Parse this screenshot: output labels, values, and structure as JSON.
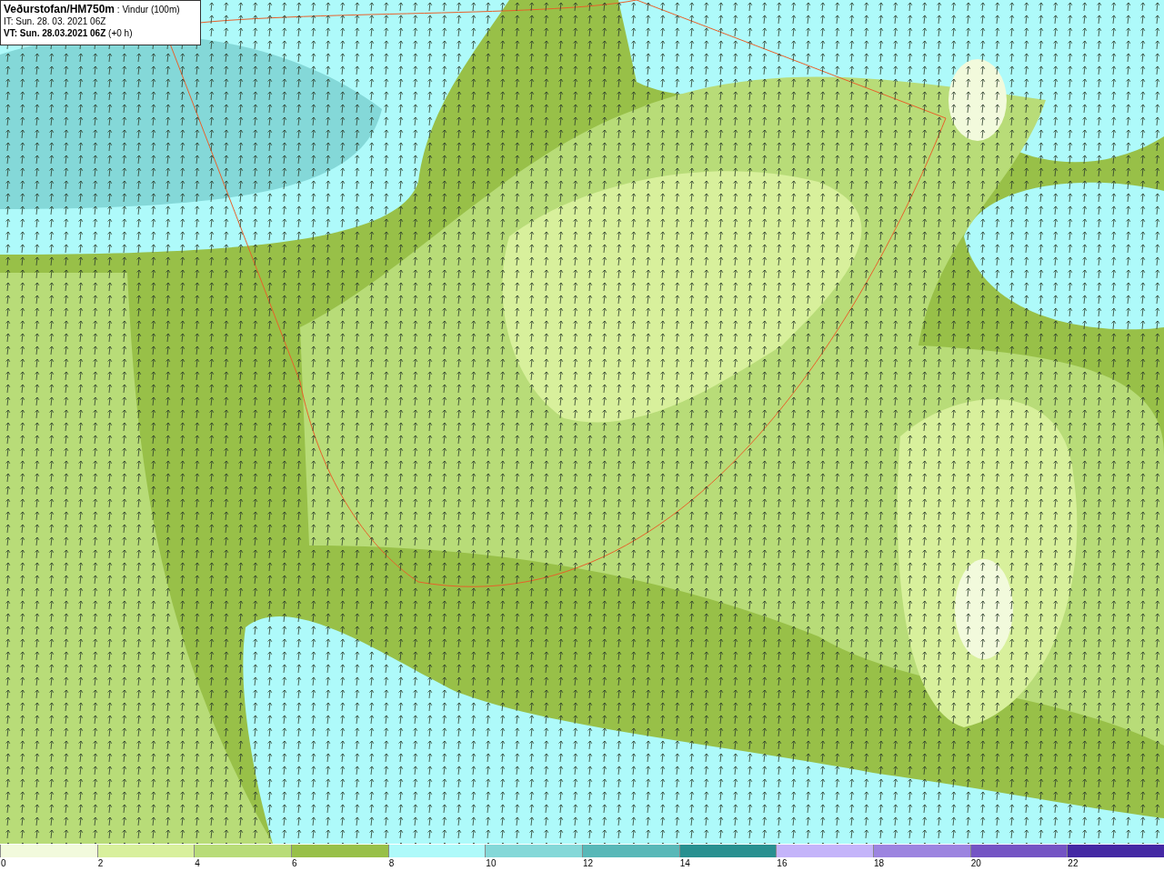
{
  "header": {
    "title": "Veðurstofan/HM750m",
    "subtitle": ": Vindur (100m)",
    "issue_time": "IT: Sun. 28. 03. 2021 06Z",
    "valid_time": "VT: Sun. 28.03.2021 06Z",
    "lead": "(+0 h)"
  },
  "legend": [
    {
      "label": "0",
      "color": "#f2fadc"
    },
    {
      "label": "2",
      "color": "#d8f09c"
    },
    {
      "label": "4",
      "color": "#b8dc78"
    },
    {
      "label": "6",
      "color": "#98c048"
    },
    {
      "label": "8",
      "color": "#aefafa"
    },
    {
      "label": "10",
      "color": "#84d8d8"
    },
    {
      "label": "12",
      "color": "#58b8b8"
    },
    {
      "label": "14",
      "color": "#289090"
    },
    {
      "label": "16",
      "color": "#c4b4fa"
    },
    {
      "label": "18",
      "color": "#9c84e0"
    },
    {
      "label": "20",
      "color": "#7454c4"
    },
    {
      "label": "22",
      "color": "#4428a4"
    }
  ]
}
